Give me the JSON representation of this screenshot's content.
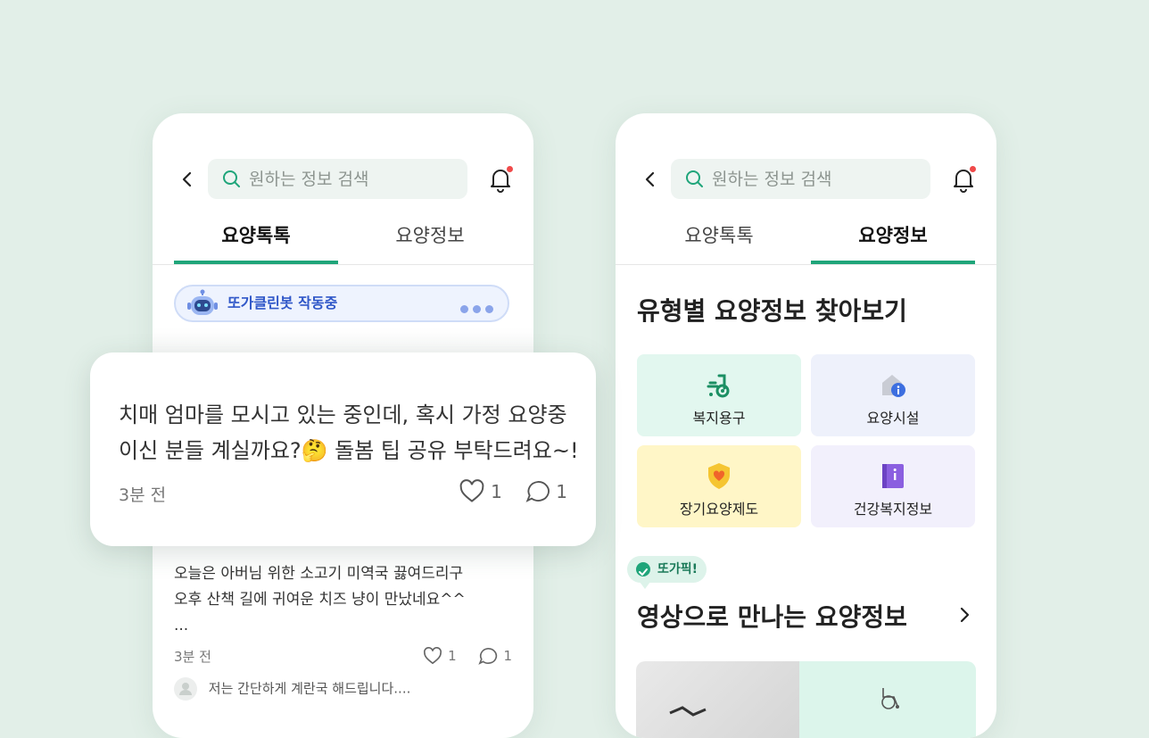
{
  "search": {
    "placeholder": "원하는 정보 검색"
  },
  "tabs": {
    "talk": "요양톡톡",
    "info": "요양정보"
  },
  "bot": {
    "label": "또가클린봇 작동중"
  },
  "featured_post": {
    "line1": "치매 엄마를 모시고 있는 중인데, 혹시 가정 요양중",
    "line2": "이신 분들 계실까요?🤔 돌봄 팁 공유 부탁드려요~!",
    "time": "3분 전",
    "likes": "1",
    "comments": "1"
  },
  "post": {
    "line1": "오늘은 아버님 위한 소고기 미역국 끓여드리구",
    "line2": "오후 산책 길에 귀여운 치즈 냥이 만났네요^^",
    "ellipsis": "...",
    "time": "3분 전",
    "likes": "1",
    "comments": "1",
    "reply": "저는 간단하게 계란국 해드립니다...."
  },
  "right": {
    "section_title": "유형별 요양정보 찾아보기",
    "categories": [
      {
        "label": "복지용구",
        "icon": "wheelchair-icon",
        "color": "#e2f7ef"
      },
      {
        "label": "요양시설",
        "icon": "facility-info-icon",
        "color": "#eef1fb"
      },
      {
        "label": "장기요양제도",
        "icon": "shield-heart-icon",
        "color": "#fff6c7"
      },
      {
        "label": "건강복지정보",
        "icon": "book-info-icon",
        "color": "#f2f0fc"
      }
    ],
    "pick_badge": "또가픽!",
    "video_title": "영상으로 만나는 요양정보"
  },
  "colors": {
    "accent": "#1fa57a",
    "background": "#e2efe8",
    "notification": "#f04a4a"
  }
}
